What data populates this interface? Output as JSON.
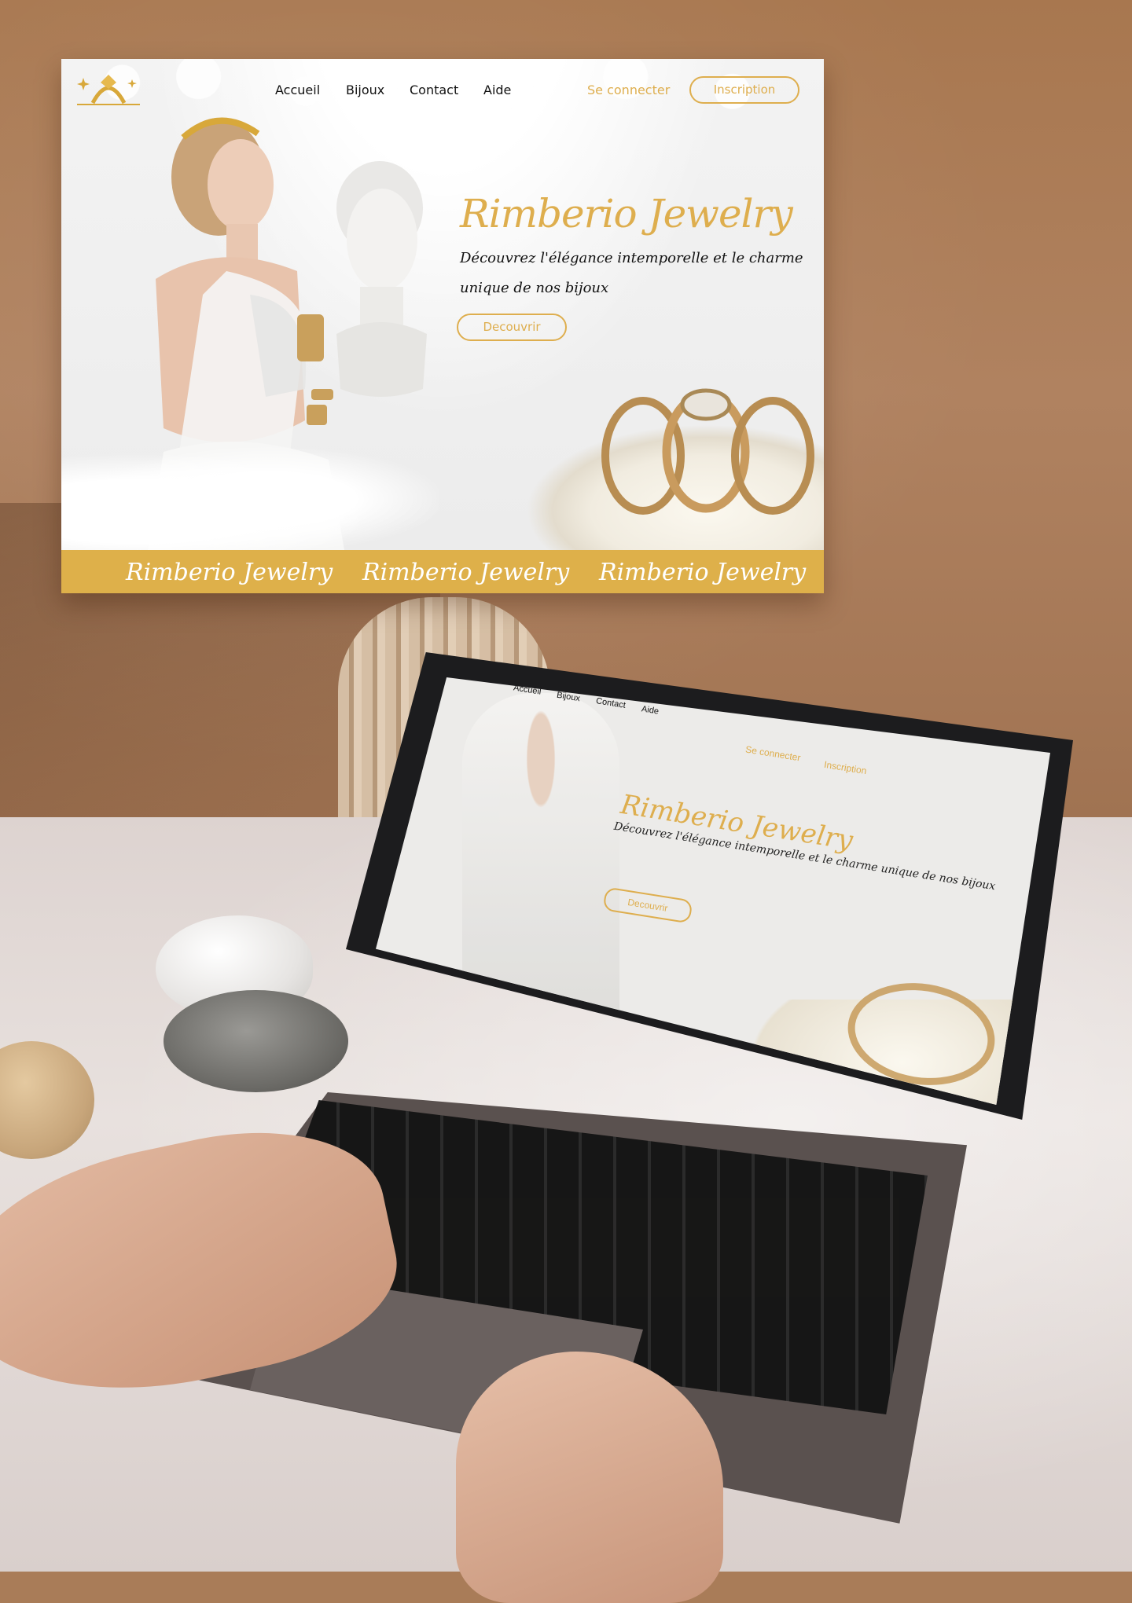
{
  "site": {
    "logo_name": "ring-logo-icon",
    "nav": {
      "links": [
        "Accueil",
        "Bijoux",
        "Contact",
        "Aide"
      ],
      "login_label": "Se connecter",
      "signup_label": "Inscription"
    },
    "hero": {
      "title": "Rimberio Jewelry",
      "subtitle": "Découvrez l'élégance intemporelle et le charme unique de nos bijoux",
      "cta_label": "Decouvrir"
    },
    "band": {
      "repeats": [
        "Rimberio Jewelry",
        "Rimberio Jewelry",
        "Rimberio Jewelry"
      ]
    }
  },
  "laptop_screen": {
    "nav": [
      "Accueil",
      "Bijoux",
      "Contact",
      "Aide"
    ],
    "login_label": "Se connecter",
    "signup_label": "Inscription",
    "title": "Rimberio Jewelry",
    "subtitle": "Découvrez l'élégance intemporelle et le charme unique de nos bijoux",
    "cta_label": "Decouvrir"
  },
  "colors": {
    "accent_gold": "#deae4e",
    "band_gold": "#deb04a",
    "hero_bg": "#eeeeee",
    "text_dark": "#111111"
  },
  "icons": [
    "ring-logo-icon",
    "sparkle-icon"
  ]
}
